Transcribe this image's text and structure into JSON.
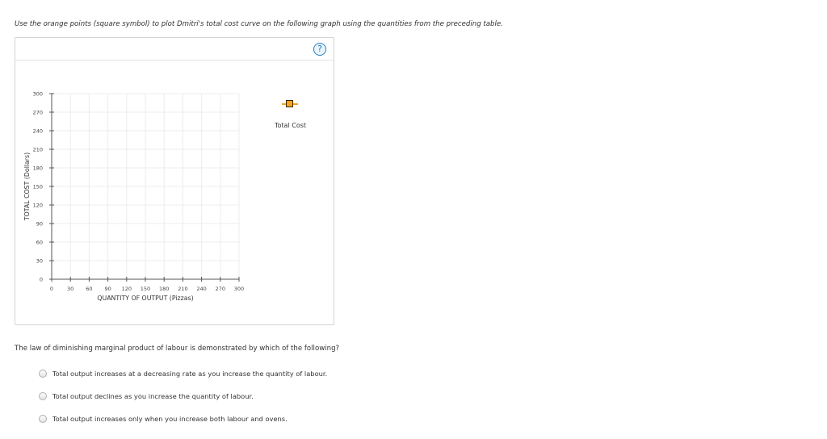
{
  "instruction": "Use the orange points (square symbol) to plot Dmitri's total cost curve on the following graph using the quantities from the preceding table.",
  "help_label": "?",
  "legend": {
    "label": "Total Cost",
    "color": "#f4a41d"
  },
  "chart_data": {
    "type": "scatter",
    "xlabel": "QUANTITY OF OUTPUT (Pizzas)",
    "ylabel": "TOTAL COST (Dollars)",
    "xlim": [
      0,
      300
    ],
    "ylim": [
      0,
      300
    ],
    "x_ticks": [
      "0",
      "30",
      "60",
      "90",
      "120",
      "150",
      "180",
      "210",
      "240",
      "270",
      "300"
    ],
    "y_ticks": [
      "0",
      "30",
      "60",
      "90",
      "120",
      "150",
      "180",
      "210",
      "240",
      "270",
      "300"
    ],
    "grid": true,
    "series": [
      {
        "name": "Total Cost",
        "points": []
      }
    ]
  },
  "question": "The law of diminishing marginal product of labour is demonstrated by which of the following?",
  "options": [
    "Total output increases at a decreasing rate as you increase the quantity of labour.",
    "Total output declines as you increase the quantity of labour.",
    "Total output increases only when you increase both labour and ovens."
  ]
}
